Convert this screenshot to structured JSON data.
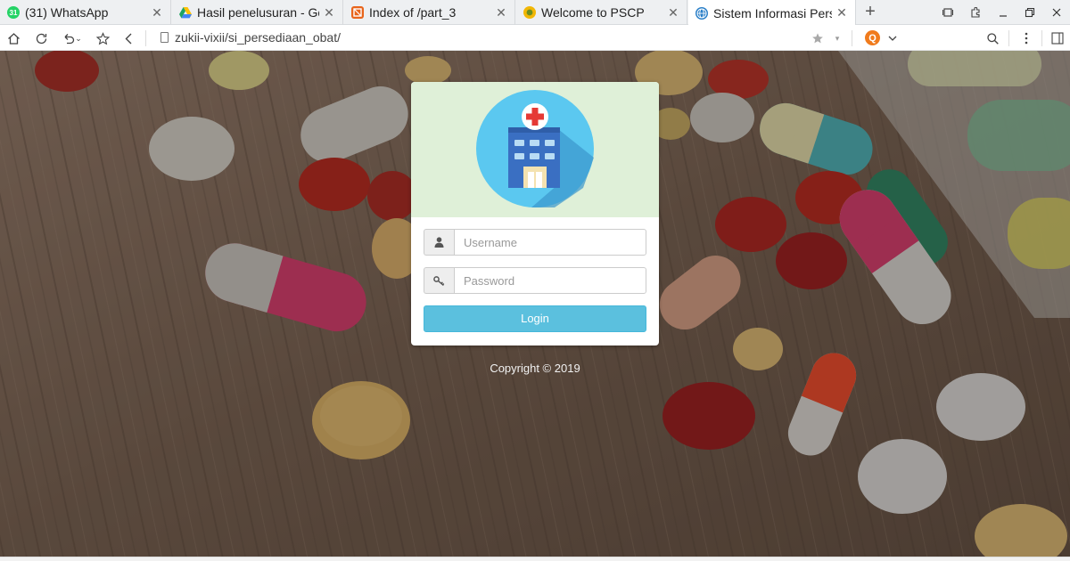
{
  "browser": {
    "tabs": [
      {
        "title": "(31) WhatsApp",
        "favicon": "whatsapp-icon",
        "color": "#25d366",
        "badge": "31"
      },
      {
        "title": "Hasil penelusuran - Goo",
        "favicon": "google-drive-icon",
        "color": "#1fa463"
      },
      {
        "title": "Index of /part_3",
        "favicon": "folder-index-icon",
        "color": "#e8641b"
      },
      {
        "title": "Welcome to PSCP",
        "favicon": "pscp-icon",
        "color": "#f2b705"
      },
      {
        "title": "Sistem Informasi Persed",
        "favicon": "globe-icon",
        "color": "#2a7fc8"
      }
    ],
    "active_tab_index": 4,
    "url": "zukii-vixii/si_persediaan_obat/",
    "search_badge": "Q"
  },
  "login": {
    "username_placeholder": "Username",
    "password_placeholder": "Password",
    "login_label": "Login",
    "username_icon": "user-icon",
    "password_icon": "key-icon"
  },
  "footer": {
    "copyright": "Copyright © 2019"
  },
  "colors": {
    "card_header": "#dff0d8",
    "button": "#5bc0de",
    "logo_circle": "#5bc8f0",
    "logo_building": "#3a6fc2",
    "logo_cross": "#e53935"
  }
}
